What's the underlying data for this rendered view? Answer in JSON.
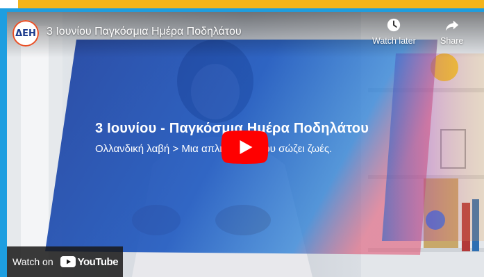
{
  "video": {
    "channel_logo_text": "ΔΕΗ",
    "title": "3 Ιουνίου Παγκόσμια Ημέρα Ποδηλάτου",
    "overlay_title": "3 Ιουνίου - Παγκόσμια Ημέρα Ποδηλάτου",
    "overlay_subtitle": "Ολλανδική λαβή > Μια απλή λαβή, που σώζει ζωές."
  },
  "controls": {
    "watch_later_label": "Watch later",
    "share_label": "Share",
    "watch_on_label": "Watch on",
    "youtube_label": "YouTube"
  },
  "icons": {
    "watch_later": "clock-icon",
    "share": "share-arrow-icon",
    "play": "play-icon",
    "youtube": "youtube-logo-icon"
  },
  "colors": {
    "accent_orange": "#f4b41a",
    "frame_blue": "#1e9ee0",
    "overlay_blue": "#1c4fb0",
    "youtube_red": "#ff0000"
  }
}
